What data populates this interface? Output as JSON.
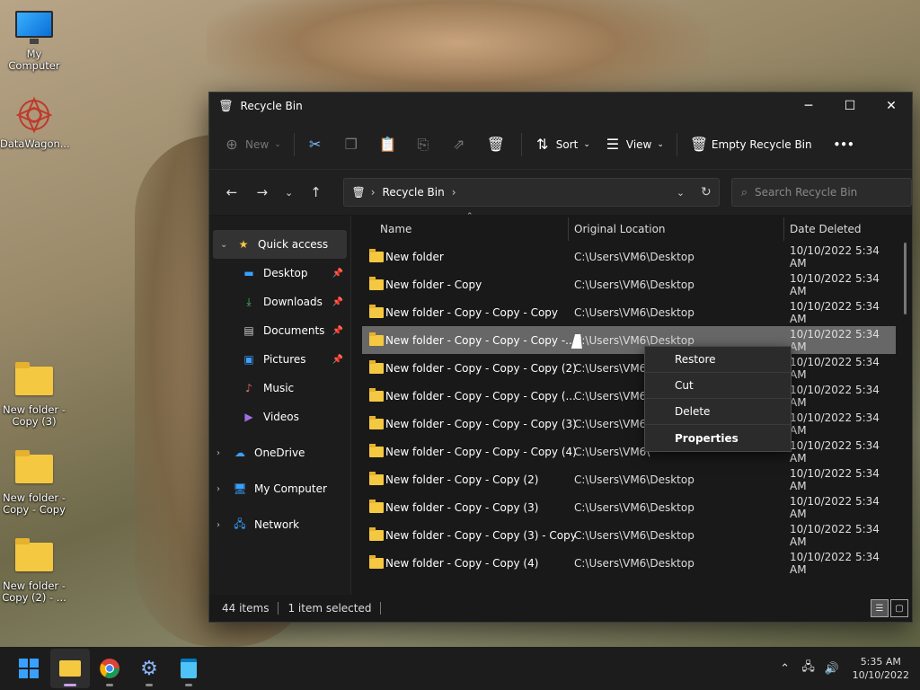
{
  "desktop": {
    "icons": [
      {
        "label": "My Computer"
      },
      {
        "label": "DataWagon..."
      },
      {
        "label": "New folder - Copy (3)"
      },
      {
        "label": "New folder - Copy - Copy"
      },
      {
        "label": "New folder - Copy (2) - ..."
      }
    ]
  },
  "window": {
    "title": "Recycle Bin",
    "controls": {
      "minimize": "─",
      "maximize": "☐",
      "close": "✕"
    }
  },
  "toolbar": {
    "new_label": "New",
    "sort_label": "Sort",
    "view_label": "View",
    "empty_label": "Empty Recycle Bin",
    "more_label": "•••"
  },
  "navbar": {
    "crumb": "Recycle Bin",
    "search_placeholder": "Search Recycle Bin"
  },
  "sidebar": {
    "quick_access": "Quick access",
    "items": [
      {
        "label": "Desktop"
      },
      {
        "label": "Downloads"
      },
      {
        "label": "Documents"
      },
      {
        "label": "Pictures"
      },
      {
        "label": "Music"
      },
      {
        "label": "Videos"
      }
    ],
    "onedrive": "OneDrive",
    "my_computer": "My Computer",
    "network": "Network"
  },
  "table": {
    "headers": {
      "name": "Name",
      "location": "Original Location",
      "date": "Date Deleted"
    },
    "rows": [
      {
        "name": "New folder",
        "location": "C:\\Users\\VM6\\Desktop",
        "date": "10/10/2022 5:34 AM"
      },
      {
        "name": "New folder - Copy",
        "location": "C:\\Users\\VM6\\Desktop",
        "date": "10/10/2022 5:34 AM"
      },
      {
        "name": "New folder - Copy - Copy - Copy",
        "location": "C:\\Users\\VM6\\Desktop",
        "date": "10/10/2022 5:34 AM"
      },
      {
        "name": "New folder - Copy - Copy - Copy -...",
        "location": "C:\\Users\\VM6\\Desktop",
        "date": "10/10/2022 5:34 AM"
      },
      {
        "name": "New folder - Copy - Copy - Copy (2)",
        "location": "C:\\Users\\VM6\\",
        "date": "10/10/2022 5:34 AM"
      },
      {
        "name": "New folder - Copy - Copy - Copy (...",
        "location": "C:\\Users\\VM6\\",
        "date": "10/10/2022 5:34 AM"
      },
      {
        "name": "New folder - Copy - Copy - Copy (3)",
        "location": "C:\\Users\\VM6\\",
        "date": "10/10/2022 5:34 AM"
      },
      {
        "name": "New folder - Copy - Copy - Copy (4)",
        "location": "C:\\Users\\VM6\\",
        "date": "10/10/2022 5:34 AM"
      },
      {
        "name": "New folder - Copy - Copy (2)",
        "location": "C:\\Users\\VM6\\Desktop",
        "date": "10/10/2022 5:34 AM"
      },
      {
        "name": "New folder - Copy - Copy (3)",
        "location": "C:\\Users\\VM6\\Desktop",
        "date": "10/10/2022 5:34 AM"
      },
      {
        "name": "New folder - Copy - Copy (3) - Copy",
        "location": "C:\\Users\\VM6\\Desktop",
        "date": "10/10/2022 5:34 AM"
      },
      {
        "name": "New folder - Copy - Copy (4)",
        "location": "C:\\Users\\VM6\\Desktop",
        "date": "10/10/2022 5:34 AM"
      }
    ]
  },
  "status": {
    "count": "44 items",
    "selected": "1 item selected"
  },
  "context_menu": {
    "items": [
      "Restore",
      "Cut",
      "Delete",
      "Properties"
    ]
  },
  "taskbar": {
    "time": "5:35 AM",
    "date": "10/10/2022"
  }
}
